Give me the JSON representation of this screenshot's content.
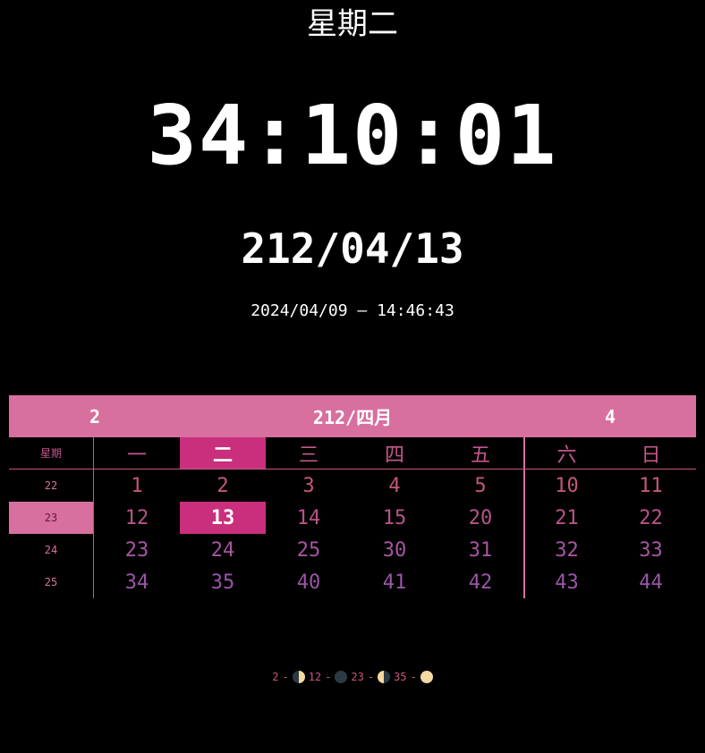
{
  "weekday_label": "星期二",
  "clock": "34:10:01",
  "alt_date": "212/04/13",
  "gregorian": "2024/04/09 — 14:46:43",
  "calendar": {
    "header_left": "2",
    "header_title": "212/四月",
    "header_right": "4",
    "week_col_label": "星期",
    "days_of_week": [
      "一",
      "二",
      "三",
      "四",
      "五",
      "六",
      "日"
    ],
    "today_col": 1,
    "active_week_row": 1,
    "rows": [
      {
        "week": "22",
        "days": [
          "1",
          "2",
          "3",
          "4",
          "5",
          "10",
          "11"
        ]
      },
      {
        "week": "23",
        "days": [
          "12",
          "13",
          "14",
          "15",
          "20",
          "21",
          "22"
        ]
      },
      {
        "week": "24",
        "days": [
          "23",
          "24",
          "25",
          "30",
          "31",
          "32",
          "33"
        ]
      },
      {
        "week": "25",
        "days": [
          "34",
          "35",
          "40",
          "41",
          "42",
          "43",
          "44"
        ]
      }
    ],
    "row_colors": [
      "#c4577f",
      "#b85389",
      "#a855a0",
      "#9a55a8"
    ]
  },
  "moon_phases": [
    {
      "day": "2",
      "phase": "first-quarter-moon-icon"
    },
    {
      "day": "12",
      "phase": "new-moon-icon"
    },
    {
      "day": "23",
      "phase": "last-quarter-moon-icon"
    },
    {
      "day": "35",
      "phase": "full-moon-icon"
    }
  ],
  "colors": {
    "accent": "#d8709f",
    "today": "#c92f7d",
    "background": "#000000"
  }
}
